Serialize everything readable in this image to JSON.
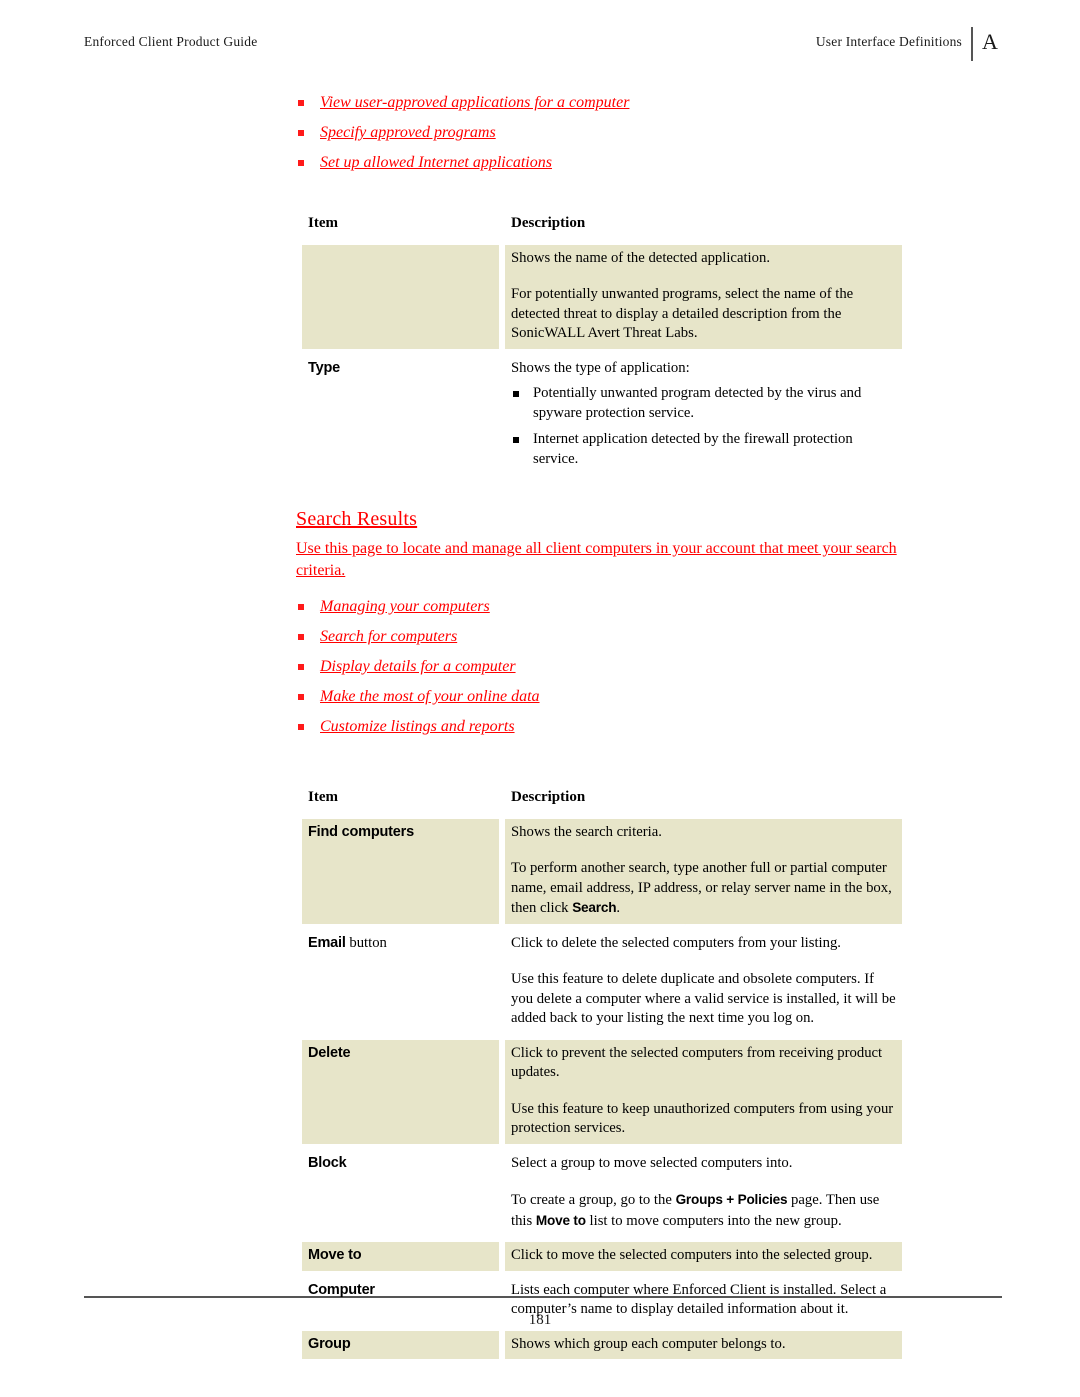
{
  "header": {
    "left_text": "Enforced Client Product Guide",
    "right_text": "User Interface Definitions",
    "appendix_tab": "A"
  },
  "footer": {
    "page_number": "181"
  },
  "colors": {
    "link_red": "#ff0000",
    "hatch_red": "#ff4d4d",
    "cell_beige": "#e7e5c9",
    "rule_gray": "#555555"
  },
  "top_links": [
    {
      "label": "View user-approved applications for a computer"
    },
    {
      "label": "Specify approved programs"
    },
    {
      "label": "Set up allowed Internet applications"
    }
  ],
  "table_one": {
    "headers": {
      "item": "Item",
      "description": "Description"
    },
    "rows": [
      {
        "item_label": "",
        "item_suffix": "",
        "shade": "beige",
        "paragraphs": [
          "Shows the name of the detected application.",
          "For potentially unwanted programs, select the name of the detected threat to display a detailed description from the SonicWALL Avert Threat Labs."
        ],
        "bullets": []
      },
      {
        "item_label": "Type",
        "item_suffix": "",
        "shade": "white",
        "paragraphs": [
          "Shows the type of application:"
        ],
        "bullets": [
          "Potentially unwanted program detected by the virus and spyware protection service.",
          "Internet application detected by the firewall protection service."
        ]
      }
    ]
  },
  "section": {
    "heading": "Search Results",
    "intro": "Use this page to locate and manage all client computers in your account that meet your search criteria."
  },
  "section_links": [
    {
      "label": "Managing your computers"
    },
    {
      "label": "Search for computers"
    },
    {
      "label": "Display details for a computer"
    },
    {
      "label": "Make the most of your online data"
    },
    {
      "label": "Customize listings and reports"
    }
  ],
  "table_two": {
    "headers": {
      "item": "Item",
      "description": "Description"
    },
    "rows": [
      {
        "item_label": "Find computers",
        "item_suffix": "",
        "shade": "beige",
        "paragraphs": [
          "Shows the search criteria.",
          "To perform another search, type another full or partial computer name, email address, IP address, or relay server name in the box, then click Search."
        ],
        "emphasis": [
          "Search"
        ]
      },
      {
        "item_label": "Email",
        "item_suffix": " button",
        "shade": "white",
        "paragraphs": [
          "Click to delete the selected computers from your listing.",
          "Use this feature to delete duplicate and obsolete computers. If you delete a computer where a valid service is installed, it will be added back to your listing the next time you log on."
        ],
        "emphasis": []
      },
      {
        "item_label": "Delete",
        "item_suffix": "",
        "shade": "beige",
        "paragraphs": [
          "Click to prevent the selected computers from receiving product updates.",
          "Use this feature to keep unauthorized computers from using your protection services."
        ],
        "emphasis": []
      },
      {
        "item_label": "Block",
        "item_suffix": "",
        "shade": "white",
        "paragraphs": [
          "Select a group to move selected computers into.",
          "To create a group, go to the Groups + Policies page. Then use this Move to list to move computers into the new group."
        ],
        "emphasis": [
          "Groups + Policies",
          "Move to"
        ]
      },
      {
        "item_label": "Move to",
        "item_suffix": "",
        "shade": "beige",
        "paragraphs": [
          "Click to move the selected computers into the selected group."
        ],
        "emphasis": []
      },
      {
        "item_label": "Computer",
        "item_suffix": "",
        "shade": "white",
        "paragraphs": [
          "Lists each computer where Enforced Client is installed. Select a computer’s name to display detailed information about it."
        ],
        "emphasis": []
      },
      {
        "item_label": "Group",
        "item_suffix": "",
        "shade": "beige",
        "paragraphs": [
          "Shows which group each computer belongs to."
        ],
        "emphasis": []
      }
    ]
  }
}
